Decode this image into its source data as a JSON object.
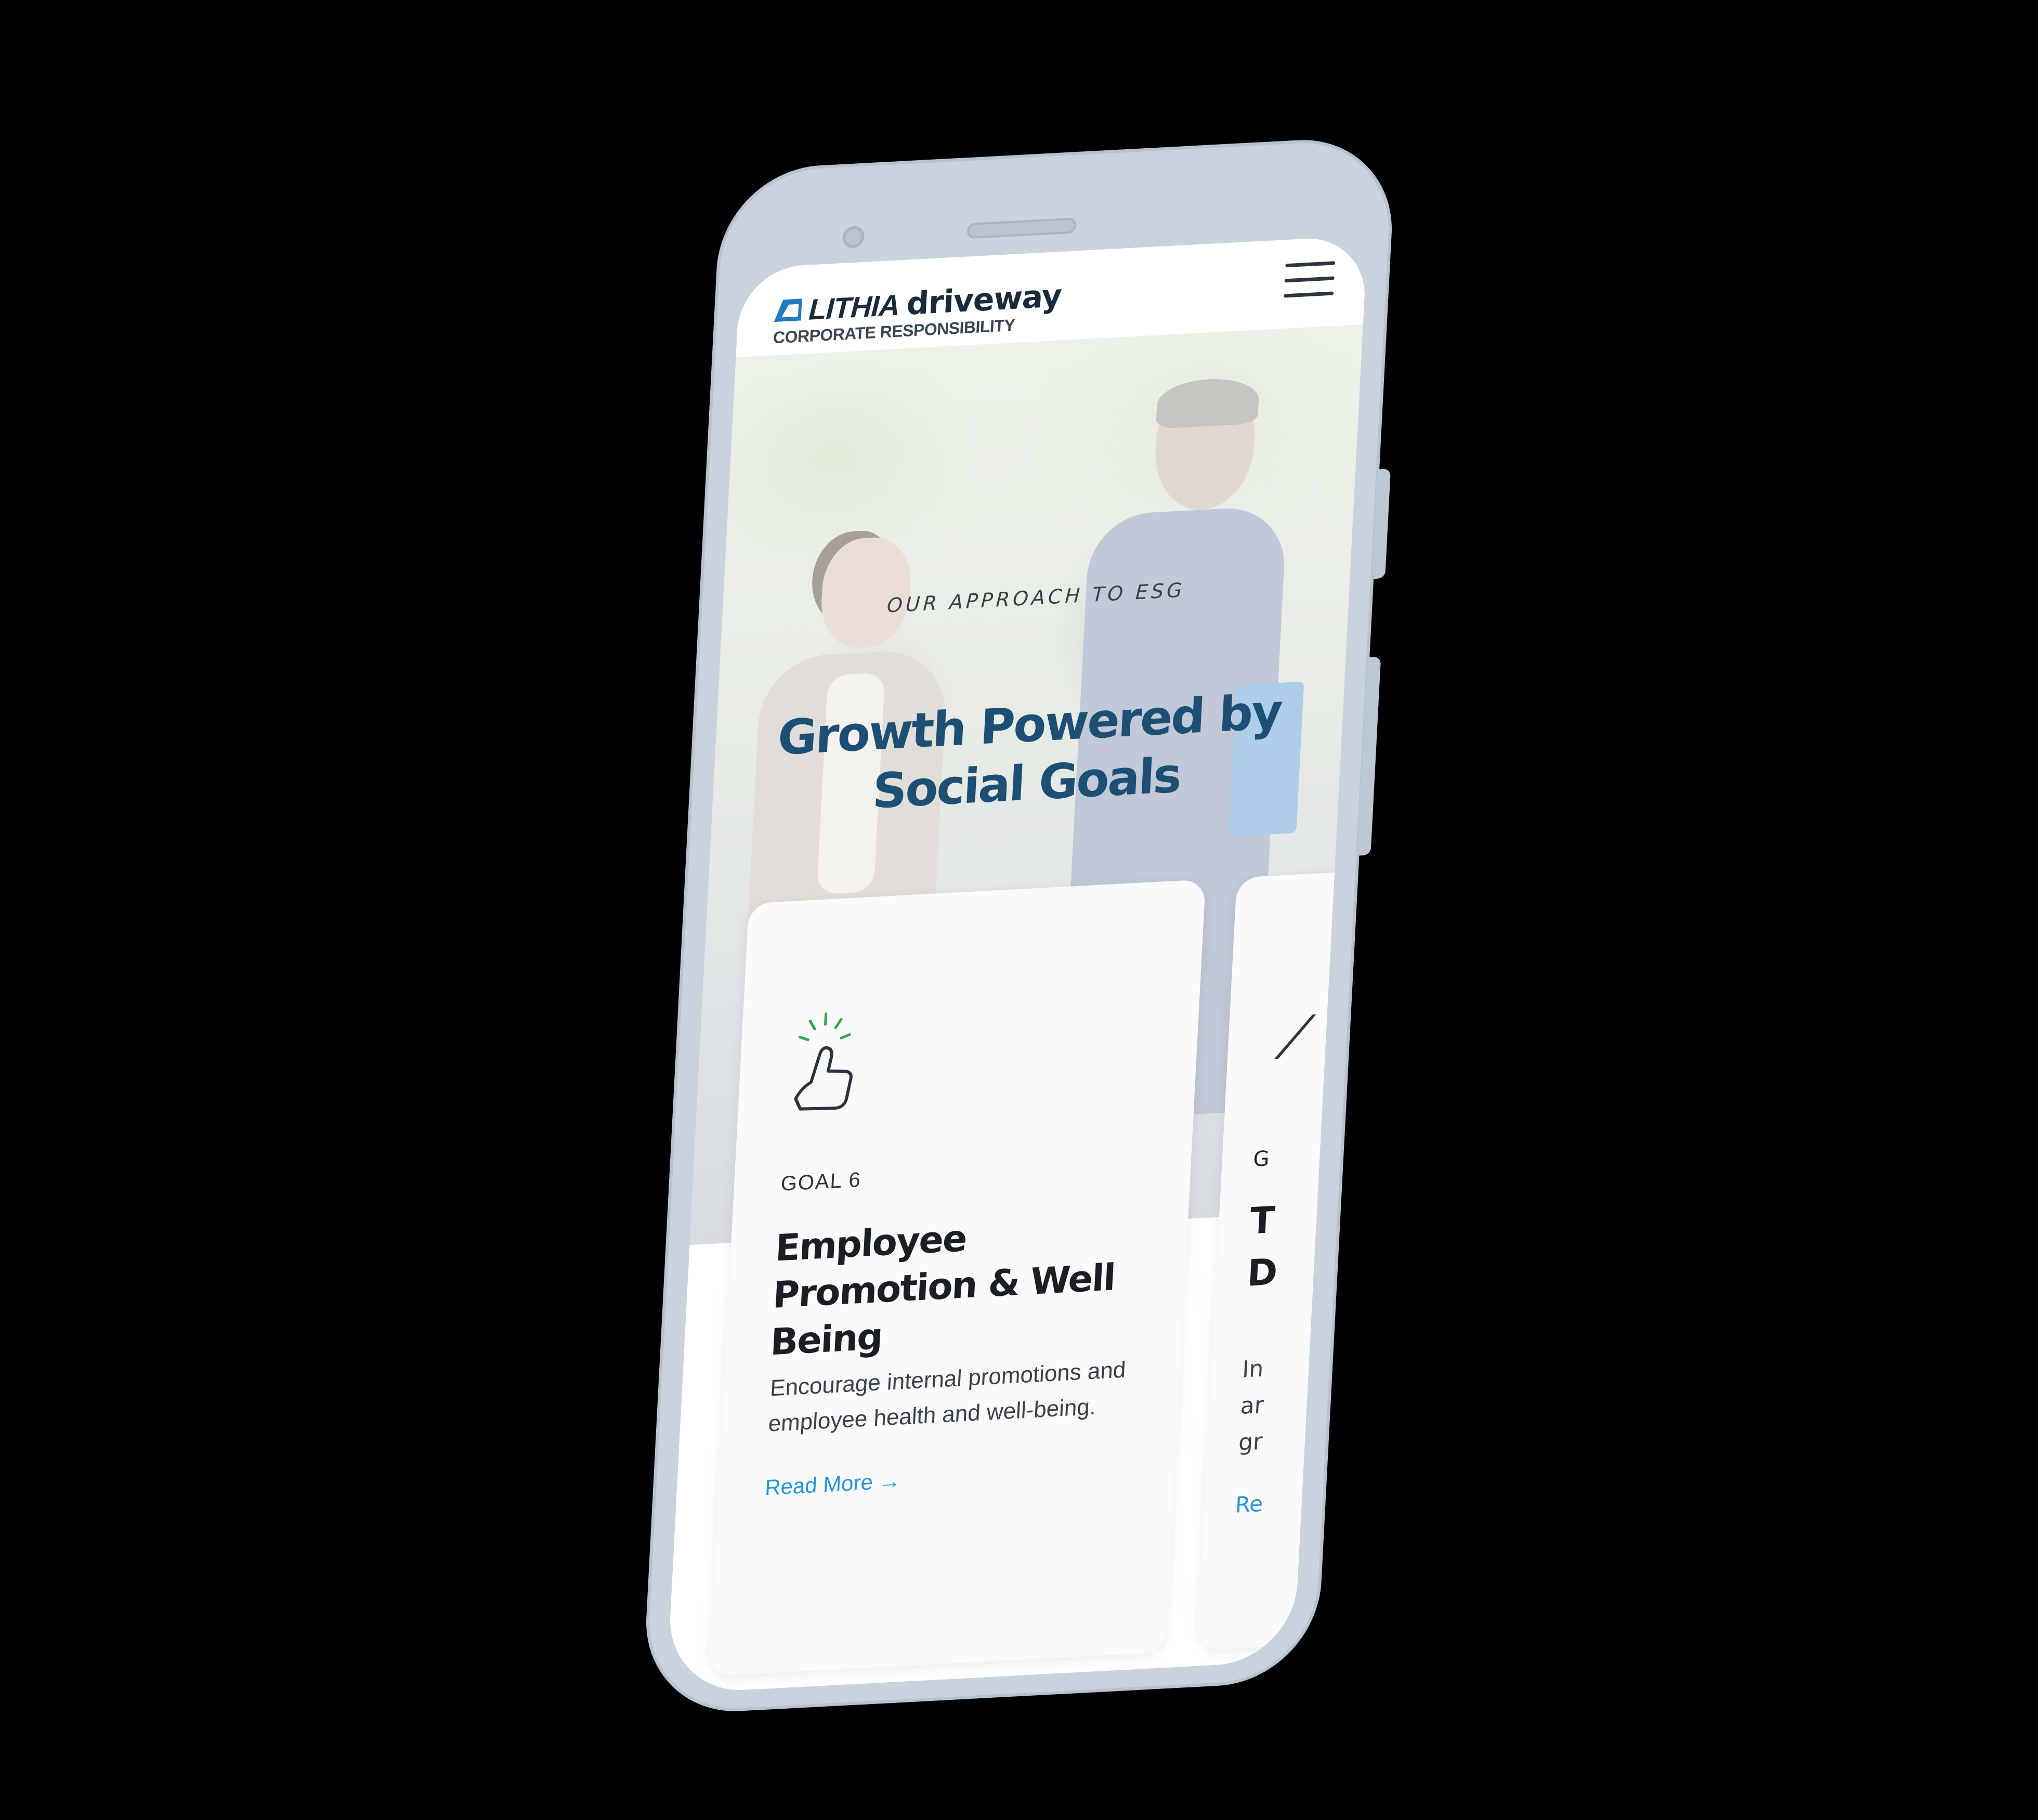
{
  "brand": {
    "lithia": "LITHIA",
    "driveway": "driveway",
    "subtitle": "CORPORATE RESPONSIBILITY"
  },
  "header": {
    "menu_icon": "hamburger-menu-icon"
  },
  "hero": {
    "eyebrow": "OUR APPROACH TO ESG",
    "title_line1": "Growth Powered by",
    "title_line2": "Social Goals"
  },
  "cards": [
    {
      "icon": "thumbs-up-icon",
      "goal": "GOAL 6",
      "title": "Employee Promotion & Well Being",
      "description": "Encourage internal promotions and employee health and well-being.",
      "link": "Read More →"
    },
    {
      "goal_partial": "G",
      "title_partial_1": "T",
      "title_partial_2": "D",
      "desc_partial_1": "In",
      "desc_partial_2": "ar",
      "desc_partial_3": "gr",
      "link_partial": "Re"
    }
  ],
  "colors": {
    "accent": "#2596d6",
    "title": "#1c4f73",
    "logo_blue": "#1f7ac2"
  }
}
